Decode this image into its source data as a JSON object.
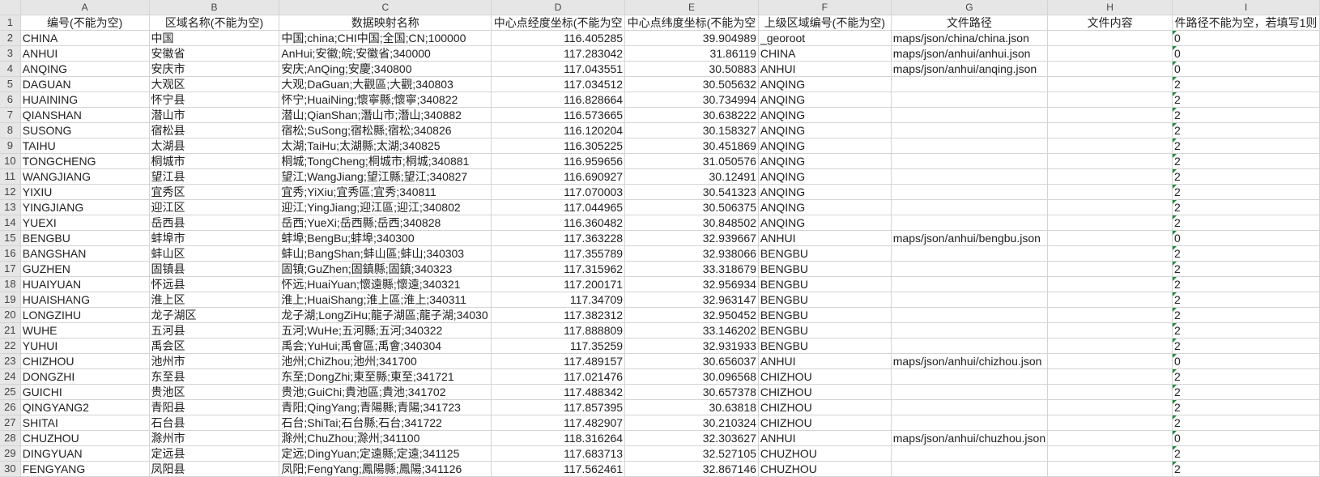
{
  "columns": [
    "A",
    "B",
    "C",
    "D",
    "E",
    "F",
    "G",
    "H",
    "I"
  ],
  "header": [
    "编号(不能为空)",
    "区域名称(不能为空)",
    "数据映射名称",
    "中心点经度坐标(不能为空",
    "中心点纬度坐标(不能为空",
    "上级区域编号(不能为空)",
    "文件路径",
    "文件内容",
    "件路径不能为空，若填写1则"
  ],
  "rows": [
    {
      "n": "2",
      "a": "CHINA",
      "b": "中国",
      "c": "中国;china;CHI中国;全国;CN;100000",
      "d": "116.405285",
      "e": "39.904989",
      "f": "_georoot",
      "g": "maps/json/china/china.json",
      "h": "",
      "i": "0"
    },
    {
      "n": "3",
      "a": "ANHUI",
      "b": "安徽省",
      "c": "AnHui;安徽;皖;安徽省;340000",
      "d": "117.283042",
      "e": "31.86119",
      "f": "CHINA",
      "g": "maps/json/anhui/anhui.json",
      "h": "",
      "i": "0"
    },
    {
      "n": "4",
      "a": "ANQING",
      "b": "安庆市",
      "c": "安庆;AnQing;安慶;340800",
      "d": "117.043551",
      "e": "30.50883",
      "f": "ANHUI",
      "g": "maps/json/anhui/anqing.json",
      "h": "",
      "i": "0"
    },
    {
      "n": "5",
      "a": "DAGUAN",
      "b": "大观区",
      "c": "大观;DaGuan;大觀區;大觀;340803",
      "d": "117.034512",
      "e": "30.505632",
      "f": "ANQING",
      "g": "",
      "h": "",
      "i": "2"
    },
    {
      "n": "6",
      "a": "HUAINING",
      "b": "怀宁县",
      "c": "怀宁;HuaiNing;懷寧縣;懷寧;340822",
      "d": "116.828664",
      "e": "30.734994",
      "f": "ANQING",
      "g": "",
      "h": "",
      "i": "2"
    },
    {
      "n": "7",
      "a": "QIANSHAN",
      "b": "潜山市",
      "c": "潜山;QianShan;潛山市;潛山;340882",
      "d": "116.573665",
      "e": "30.638222",
      "f": "ANQING",
      "g": "",
      "h": "",
      "i": "2"
    },
    {
      "n": "8",
      "a": "SUSONG",
      "b": "宿松县",
      "c": "宿松;SuSong;宿松縣;宿松;340826",
      "d": "116.120204",
      "e": "30.158327",
      "f": "ANQING",
      "g": "",
      "h": "",
      "i": "2"
    },
    {
      "n": "9",
      "a": "TAIHU",
      "b": "太湖县",
      "c": "太湖;TaiHu;太湖縣;太湖;340825",
      "d": "116.305225",
      "e": "30.451869",
      "f": "ANQING",
      "g": "",
      "h": "",
      "i": "2"
    },
    {
      "n": "10",
      "a": "TONGCHENG",
      "b": "桐城市",
      "c": "桐城;TongCheng;桐城市;桐城;340881",
      "d": "116.959656",
      "e": "31.050576",
      "f": "ANQING",
      "g": "",
      "h": "",
      "i": "2"
    },
    {
      "n": "11",
      "a": "WANGJIANG",
      "b": "望江县",
      "c": "望江;WangJiang;望江縣;望江;340827",
      "d": "116.690927",
      "e": "30.12491",
      "f": "ANQING",
      "g": "",
      "h": "",
      "i": "2"
    },
    {
      "n": "12",
      "a": "YIXIU",
      "b": "宜秀区",
      "c": "宜秀;YiXiu;宜秀區;宜秀;340811",
      "d": "117.070003",
      "e": "30.541323",
      "f": "ANQING",
      "g": "",
      "h": "",
      "i": "2"
    },
    {
      "n": "13",
      "a": "YINGJIANG",
      "b": "迎江区",
      "c": "迎江;YingJiang;迎江區;迎江;340802",
      "d": "117.044965",
      "e": "30.506375",
      "f": "ANQING",
      "g": "",
      "h": "",
      "i": "2"
    },
    {
      "n": "14",
      "a": "YUEXI",
      "b": "岳西县",
      "c": "岳西;YueXi;岳西縣;岳西;340828",
      "d": "116.360482",
      "e": "30.848502",
      "f": "ANQING",
      "g": "",
      "h": "",
      "i": "2"
    },
    {
      "n": "15",
      "a": "BENGBU",
      "b": "蚌埠市",
      "c": "蚌埠;BengBu;蚌埠;340300",
      "d": "117.363228",
      "e": "32.939667",
      "f": "ANHUI",
      "g": "maps/json/anhui/bengbu.json",
      "h": "",
      "i": "0"
    },
    {
      "n": "16",
      "a": "BANGSHAN",
      "b": "蚌山区",
      "c": "蚌山;BangShan;蚌山區;蚌山;340303",
      "d": "117.355789",
      "e": "32.938066",
      "f": "BENGBU",
      "g": "",
      "h": "",
      "i": "2"
    },
    {
      "n": "17",
      "a": "GUZHEN",
      "b": "固镇县",
      "c": "固镇;GuZhen;固鎮縣;固鎮;340323",
      "d": "117.315962",
      "e": "33.318679",
      "f": "BENGBU",
      "g": "",
      "h": "",
      "i": "2"
    },
    {
      "n": "18",
      "a": "HUAIYUAN",
      "b": "怀远县",
      "c": "怀远;HuaiYuan;懷遠縣;懷遠;340321",
      "d": "117.200171",
      "e": "32.956934",
      "f": "BENGBU",
      "g": "",
      "h": "",
      "i": "2"
    },
    {
      "n": "19",
      "a": "HUAISHANG",
      "b": "淮上区",
      "c": "淮上;HuaiShang;淮上區;淮上;340311",
      "d": "117.34709",
      "e": "32.963147",
      "f": "BENGBU",
      "g": "",
      "h": "",
      "i": "2"
    },
    {
      "n": "20",
      "a": "LONGZIHU",
      "b": "龙子湖区",
      "c": "龙子湖;LongZiHu;龍子湖區;龍子湖;34030",
      "d": "117.382312",
      "e": "32.950452",
      "f": "BENGBU",
      "g": "",
      "h": "",
      "i": "2"
    },
    {
      "n": "21",
      "a": "WUHE",
      "b": "五河县",
      "c": "五河;WuHe;五河縣;五河;340322",
      "d": "117.888809",
      "e": "33.146202",
      "f": "BENGBU",
      "g": "",
      "h": "",
      "i": "2"
    },
    {
      "n": "22",
      "a": "YUHUI",
      "b": "禹会区",
      "c": "禹会;YuHui;禹會區;禹會;340304",
      "d": "117.35259",
      "e": "32.931933",
      "f": "BENGBU",
      "g": "",
      "h": "",
      "i": "2"
    },
    {
      "n": "23",
      "a": "CHIZHOU",
      "b": "池州市",
      "c": "池州;ChiZhou;池州;341700",
      "d": "117.489157",
      "e": "30.656037",
      "f": "ANHUI",
      "g": "maps/json/anhui/chizhou.json",
      "h": "",
      "i": "0"
    },
    {
      "n": "24",
      "a": "DONGZHI",
      "b": "东至县",
      "c": "东至;DongZhi;東至縣;東至;341721",
      "d": "117.021476",
      "e": "30.096568",
      "f": "CHIZHOU",
      "g": "",
      "h": "",
      "i": "2"
    },
    {
      "n": "25",
      "a": "GUICHI",
      "b": "贵池区",
      "c": "贵池;GuiChi;貴池區;貴池;341702",
      "d": "117.488342",
      "e": "30.657378",
      "f": "CHIZHOU",
      "g": "",
      "h": "",
      "i": "2"
    },
    {
      "n": "26",
      "a": "QINGYANG2",
      "b": "青阳县",
      "c": "青阳;QingYang;青陽縣;青陽;341723",
      "d": "117.857395",
      "e": "30.63818",
      "f": "CHIZHOU",
      "g": "",
      "h": "",
      "i": "2"
    },
    {
      "n": "27",
      "a": "SHITAI",
      "b": "石台县",
      "c": "石台;ShiTai;石台縣;石台;341722",
      "d": "117.482907",
      "e": "30.210324",
      "f": "CHIZHOU",
      "g": "",
      "h": "",
      "i": "2"
    },
    {
      "n": "28",
      "a": "CHUZHOU",
      "b": "滁州市",
      "c": "滁州;ChuZhou;滁州;341100",
      "d": "118.316264",
      "e": "32.303627",
      "f": "ANHUI",
      "g": "maps/json/anhui/chuzhou.json",
      "h": "",
      "i": "0"
    },
    {
      "n": "29",
      "a": "DINGYUAN",
      "b": "定远县",
      "c": "定远;DingYuan;定遠縣;定遠;341125",
      "d": "117.683713",
      "e": "32.527105",
      "f": "CHUZHOU",
      "g": "",
      "h": "",
      "i": "2"
    },
    {
      "n": "30",
      "a": "FENGYANG",
      "b": "凤阳县",
      "c": "凤阳;FengYang;鳳陽縣;鳳陽;341126",
      "d": "117.562461",
      "e": "32.867146",
      "f": "CHUZHOU",
      "g": "",
      "h": "",
      "i": "2"
    }
  ]
}
